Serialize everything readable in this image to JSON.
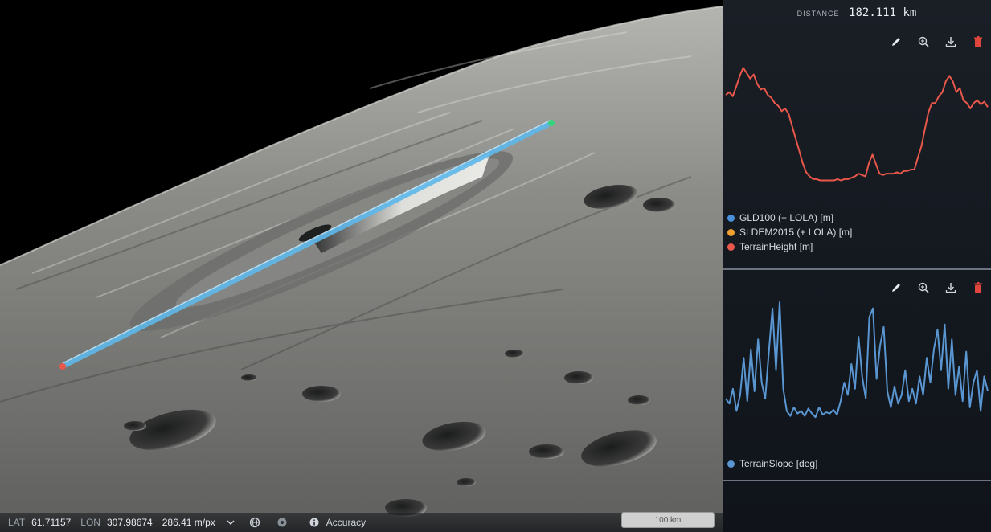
{
  "status_bar": {
    "lat_label": "LAT",
    "lat_value": "61.71157",
    "lon_label": "LON",
    "lon_value": "307.98674",
    "resolution": "286.41 m/px",
    "accuracy_label": "Accuracy",
    "icons": [
      "chevron-down-icon",
      "globe-icon",
      "settings-icon",
      "info-icon"
    ]
  },
  "scale_bar": {
    "label": "100 km"
  },
  "measurement": {
    "distance_label": "DISTANCE",
    "distance_value": "182.111 km"
  },
  "toolbar_icons": [
    "pencil-icon",
    "zoom-in-icon",
    "download-icon",
    "delete-icon"
  ],
  "colors": {
    "gld100": "#4a90d9",
    "sldem2015": "#f0a030",
    "terrain_height": "#e8574a",
    "terrain_slope": "#5a96d2",
    "measure_line": "#5fb8ea",
    "delete": "#e0463c"
  },
  "height_profile": {
    "legend": [
      {
        "label": "GLD100 (+ LOLA) [m]",
        "color": "#4a90d9"
      },
      {
        "label": "SLDEM2015 (+ LOLA) [m]",
        "color": "#f0a030"
      },
      {
        "label": "TerrainHeight [m]",
        "color": "#e8574a"
      }
    ],
    "chart_data": {
      "type": "line",
      "series_name": "TerrainHeight [m]",
      "values": [
        0.68,
        0.7,
        0.67,
        0.74,
        0.82,
        0.88,
        0.84,
        0.8,
        0.83,
        0.76,
        0.72,
        0.73,
        0.68,
        0.66,
        0.62,
        0.6,
        0.56,
        0.58,
        0.54,
        0.45,
        0.36,
        0.27,
        0.18,
        0.11,
        0.08,
        0.06,
        0.06,
        0.05,
        0.05,
        0.05,
        0.05,
        0.05,
        0.06,
        0.05,
        0.06,
        0.06,
        0.07,
        0.08,
        0.1,
        0.09,
        0.08,
        0.18,
        0.24,
        0.17,
        0.1,
        0.09,
        0.1,
        0.1,
        0.1,
        0.11,
        0.1,
        0.12,
        0.12,
        0.13,
        0.13,
        0.22,
        0.3,
        0.43,
        0.55,
        0.62,
        0.62,
        0.67,
        0.7,
        0.78,
        0.82,
        0.78,
        0.7,
        0.73,
        0.64,
        0.62,
        0.58,
        0.62,
        0.64,
        0.61,
        0.63,
        0.59
      ]
    }
  },
  "slope_profile": {
    "legend": [
      {
        "label": "TerrainSlope [deg]",
        "color": "#5a96d2"
      }
    ],
    "chart_data": {
      "type": "line",
      "series_name": "TerrainSlope [deg]",
      "values": [
        0.22,
        0.18,
        0.3,
        0.12,
        0.25,
        0.55,
        0.2,
        0.62,
        0.28,
        0.7,
        0.35,
        0.22,
        0.6,
        0.95,
        0.45,
        1.0,
        0.3,
        0.12,
        0.08,
        0.15,
        0.1,
        0.12,
        0.08,
        0.14,
        0.1,
        0.07,
        0.15,
        0.09,
        0.11,
        0.1,
        0.13,
        0.09,
        0.2,
        0.35,
        0.25,
        0.5,
        0.3,
        0.72,
        0.4,
        0.22,
        0.88,
        0.95,
        0.38,
        0.65,
        0.8,
        0.28,
        0.15,
        0.32,
        0.18,
        0.25,
        0.45,
        0.2,
        0.3,
        0.18,
        0.4,
        0.25,
        0.55,
        0.35,
        0.62,
        0.78,
        0.45,
        0.82,
        0.3,
        0.7,
        0.25,
        0.48,
        0.2,
        0.6,
        0.15,
        0.35,
        0.45,
        0.12,
        0.4,
        0.28
      ]
    }
  }
}
